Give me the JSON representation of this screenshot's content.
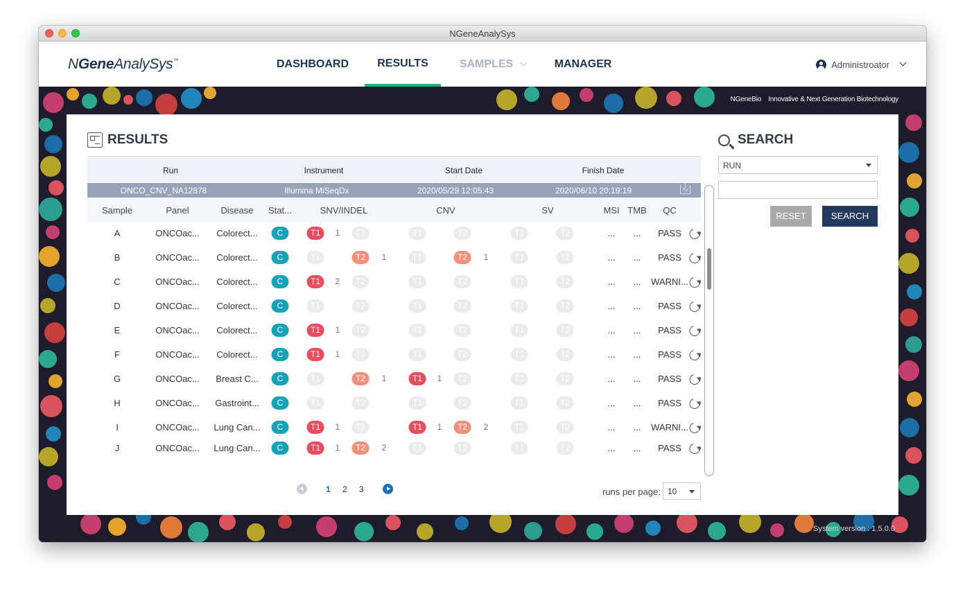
{
  "window": {
    "title": "NGeneAnalySys"
  },
  "appbar": {
    "logo_light": "N",
    "logo_bold": "Gene",
    "logo_rest": "AnalySys",
    "logo_tm": "™",
    "nav": [
      {
        "label": "DASHBOARD",
        "state": "normal"
      },
      {
        "label": "RESULTS",
        "state": "active"
      },
      {
        "label": "SAMPLES",
        "state": "disabled"
      },
      {
        "label": "MANAGER",
        "state": "normal"
      }
    ],
    "user": "Administroator"
  },
  "banner": {
    "brand": "NGeneBio",
    "slogan": "Innovative & Next Generation Biotechnology"
  },
  "footer": {
    "version": "System version : 1.5.0.0"
  },
  "results": {
    "title": "RESULTS",
    "columns": [
      "Run",
      "Instrument",
      "Start Date",
      "Finish Date"
    ],
    "run": {
      "name": "ONCO_CNV_NA12878",
      "instrument": "Illumina MiSeqDx",
      "start": "2020/05/29 12:05:43",
      "finish": "2020/06/10 20:19:19"
    },
    "sub_columns": [
      "Sample",
      "Panel",
      "Disease",
      "Stat...",
      "SNV/INDEL",
      "CNV",
      "SV",
      "MSI",
      "TMB",
      "QC"
    ],
    "status_label": "C",
    "t1_label": "T1",
    "t2_label": "T2",
    "rows": [
      {
        "sample": "A",
        "panel": "ONCOac...",
        "disease": "Colorect...",
        "snv_t1": "1",
        "snv_t2": "",
        "cnv_t1": "",
        "cnv_t2": "",
        "msi": "...",
        "tmb": "...",
        "qc": "PASS"
      },
      {
        "sample": "B",
        "panel": "ONCOac...",
        "disease": "Colorect...",
        "snv_t1": "",
        "snv_t2": "1",
        "cnv_t1": "",
        "cnv_t2": "1",
        "msi": "...",
        "tmb": "...",
        "qc": "PASS"
      },
      {
        "sample": "C",
        "panel": "ONCOac...",
        "disease": "Colorect...",
        "snv_t1": "2",
        "snv_t2": "",
        "cnv_t1": "",
        "cnv_t2": "",
        "msi": "...",
        "tmb": "...",
        "qc": "WARNI..."
      },
      {
        "sample": "D",
        "panel": "ONCOac...",
        "disease": "Colorect...",
        "snv_t1": "",
        "snv_t2": "",
        "cnv_t1": "",
        "cnv_t2": "",
        "msi": "...",
        "tmb": "...",
        "qc": "PASS"
      },
      {
        "sample": "E",
        "panel": "ONCOac...",
        "disease": "Colorect...",
        "snv_t1": "1",
        "snv_t2": "",
        "cnv_t1": "",
        "cnv_t2": "",
        "msi": "...",
        "tmb": "...",
        "qc": "PASS"
      },
      {
        "sample": "F",
        "panel": "ONCOac...",
        "disease": "Colorect...",
        "snv_t1": "1",
        "snv_t2": "",
        "cnv_t1": "",
        "cnv_t2": "",
        "msi": "...",
        "tmb": "...",
        "qc": "PASS"
      },
      {
        "sample": "G",
        "panel": "ONCOac...",
        "disease": "Breast C...",
        "snv_t1": "",
        "snv_t2": "1",
        "cnv_t1": "1",
        "cnv_t2": "",
        "msi": "...",
        "tmb": "...",
        "qc": "PASS"
      },
      {
        "sample": "H",
        "panel": "ONCOac...",
        "disease": "Gastroint...",
        "snv_t1": "",
        "snv_t2": "",
        "cnv_t1": "",
        "cnv_t2": "",
        "msi": "...",
        "tmb": "...",
        "qc": "PASS"
      },
      {
        "sample": "I",
        "panel": "ONCOac...",
        "disease": "Lung Can...",
        "snv_t1": "1",
        "snv_t2": "",
        "cnv_t1": "1",
        "cnv_t2": "2",
        "msi": "...",
        "tmb": "...",
        "qc": "WARNI..."
      },
      {
        "sample": "J",
        "panel": "ONCOac...",
        "disease": "Lung Can...",
        "snv_t1": "1",
        "snv_t2": "2",
        "cnv_t1": "",
        "cnv_t2": "",
        "msi": "...",
        "tmb": "...",
        "qc": "PASS"
      }
    ],
    "pagination": {
      "pages": [
        "1",
        "2",
        "3"
      ],
      "current": "1",
      "runs_per_page_label": "runs per page:",
      "runs_per_page": "10"
    }
  },
  "search": {
    "title": "SEARCH",
    "field": "RUN",
    "query": "",
    "reset_label": "RESET",
    "search_label": "SEARCH"
  },
  "colors": {
    "navy": "#1f3354",
    "active_tab": "#1cb47e",
    "status_c": "#17a2b8",
    "tier1": "#e84c5f",
    "tier2": "#f48f7c",
    "run_row": "#98a2b9",
    "background": "#1e1b2a"
  }
}
